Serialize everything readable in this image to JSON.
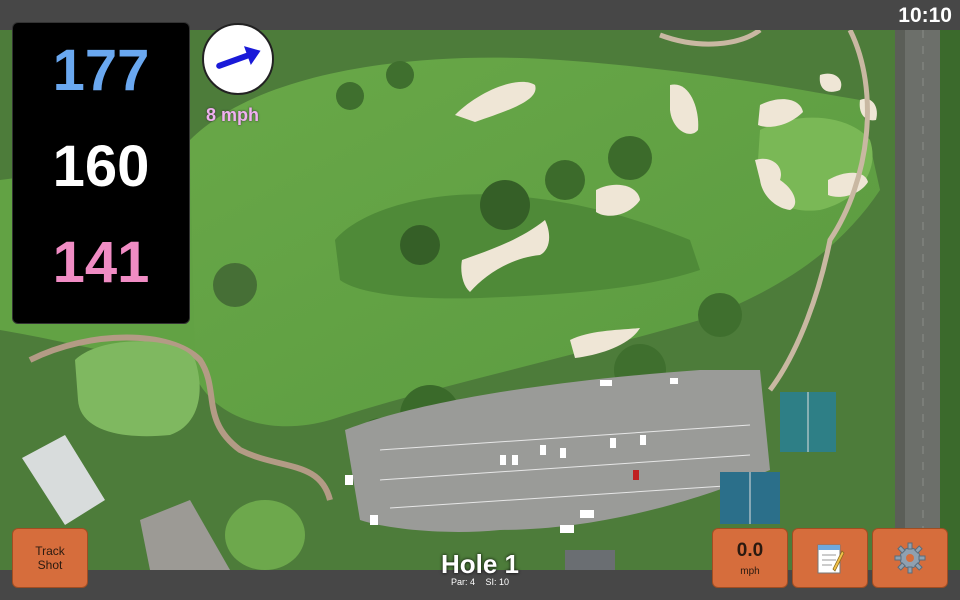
{
  "clock": "10:10",
  "distances": {
    "back": "177",
    "middle": "160",
    "front": "141",
    "colors": {
      "back": "#6aa8f0",
      "middle": "#ffffff",
      "front": "#f08cc4"
    }
  },
  "wind": {
    "speed_label": "8 mph",
    "direction_icon": "arrow-right-icon",
    "arrow_color": "#1a1ad8"
  },
  "buttons": {
    "track_shot": "Track\nShot",
    "wind_value": "0.0",
    "wind_unit": "mph",
    "notes_icon": "notepad-icon",
    "settings_icon": "gear-icon",
    "accent": "#d66d3c"
  },
  "hole": {
    "title": "Hole 1",
    "par": "Par: 4",
    "si": "SI: 10"
  }
}
